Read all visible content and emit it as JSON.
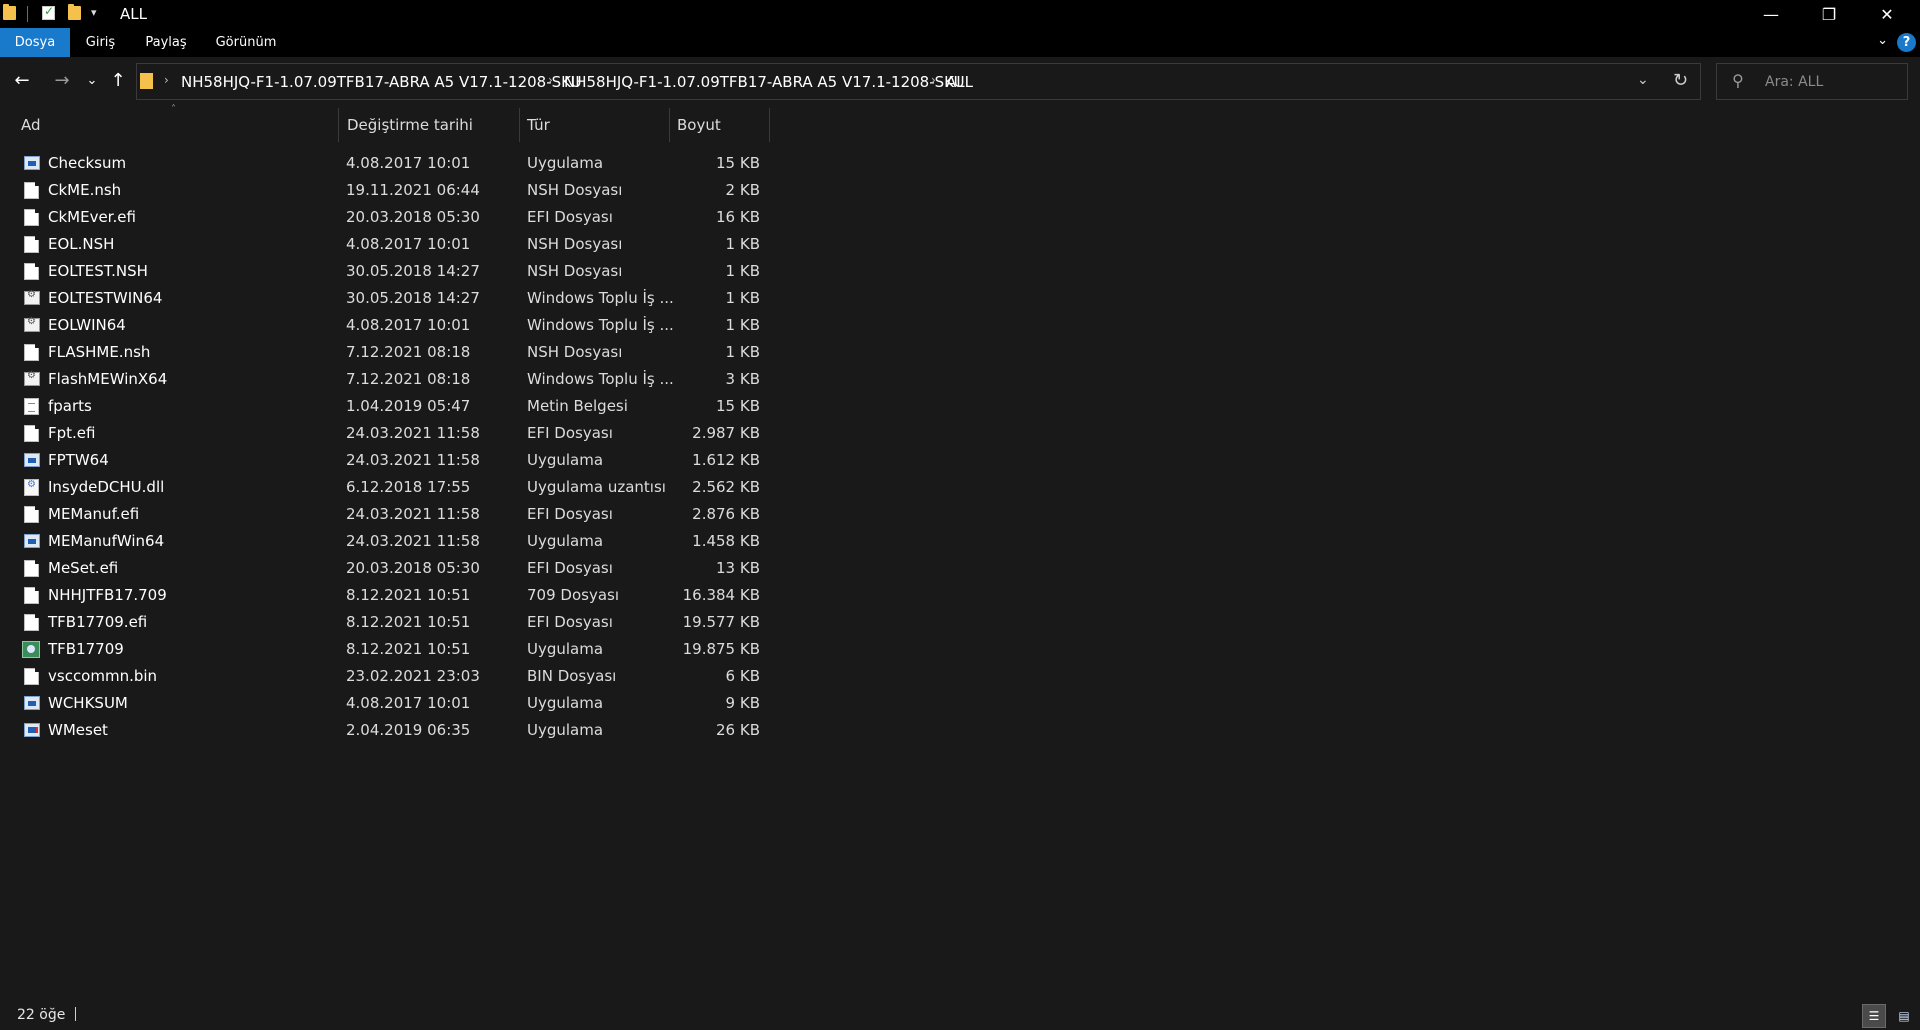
{
  "window": {
    "title": "ALL",
    "controls": {
      "minimize": "—",
      "restore": "❐",
      "close": "✕"
    }
  },
  "quick_access": {
    "dropdown_glyph": "▾"
  },
  "ribbon": {
    "tabs": [
      {
        "label": "Dosya",
        "active": true
      },
      {
        "label": "Giriş"
      },
      {
        "label": "Paylaş"
      },
      {
        "label": "Görünüm"
      }
    ],
    "collapse_glyph": "⌄",
    "help_glyph": "?"
  },
  "nav": {
    "back": "←",
    "forward": "→",
    "recent": "⌄",
    "up": "↑"
  },
  "address": {
    "crumbs": [
      "NH58HJQ-F1-1.07.09TFB17-ABRA A5 V17.1-1208-SKU",
      "NH58HJQ-F1-1.07.09TFB17-ABRA A5 V17.1-1208-SKU",
      "ALL"
    ],
    "separator": "›",
    "dropdown_glyph": "⌄",
    "refresh_glyph": "↻"
  },
  "search": {
    "placeholder": "Ara: ALL",
    "icon_glyph": "⚲"
  },
  "columns": {
    "name": "Ad",
    "date": "Değiştirme tarihi",
    "type": "Tür",
    "size": "Boyut",
    "sort_glyph": "˄"
  },
  "files": [
    {
      "name": "Checksum",
      "date": "4.08.2017 10:01",
      "type": "Uygulama",
      "size": "15 KB",
      "icon": "application-icon"
    },
    {
      "name": "CkME.nsh",
      "date": "19.11.2021 06:44",
      "type": "NSH Dosyası",
      "size": "2 KB",
      "icon": "file-icon"
    },
    {
      "name": "CkMEver.efi",
      "date": "20.03.2018 05:30",
      "type": "EFI Dosyası",
      "size": "16 KB",
      "icon": "file-icon"
    },
    {
      "name": "EOL.NSH",
      "date": "4.08.2017 10:01",
      "type": "NSH Dosyası",
      "size": "1 KB",
      "icon": "file-icon"
    },
    {
      "name": "EOLTEST.NSH",
      "date": "30.05.2018 14:27",
      "type": "NSH Dosyası",
      "size": "1 KB",
      "icon": "file-icon"
    },
    {
      "name": "EOLTESTWIN64",
      "date": "30.05.2018 14:27",
      "type": "Windows Toplu İş ...",
      "size": "1 KB",
      "icon": "batch-file-icon"
    },
    {
      "name": "EOLWIN64",
      "date": "4.08.2017 10:01",
      "type": "Windows Toplu İş ...",
      "size": "1 KB",
      "icon": "batch-file-icon"
    },
    {
      "name": "FLASHME.nsh",
      "date": "7.12.2021 08:18",
      "type": "NSH Dosyası",
      "size": "1 KB",
      "icon": "file-icon"
    },
    {
      "name": "FlashMEWinX64",
      "date": "7.12.2021 08:18",
      "type": "Windows Toplu İş ...",
      "size": "3 KB",
      "icon": "batch-file-icon"
    },
    {
      "name": "fparts",
      "date": "1.04.2019 05:47",
      "type": "Metin Belgesi",
      "size": "15 KB",
      "icon": "text-document-icon"
    },
    {
      "name": "Fpt.efi",
      "date": "24.03.2021 11:58",
      "type": "EFI Dosyası",
      "size": "2.987 KB",
      "icon": "file-icon"
    },
    {
      "name": "FPTW64",
      "date": "24.03.2021 11:58",
      "type": "Uygulama",
      "size": "1.612 KB",
      "icon": "application-icon"
    },
    {
      "name": "InsydeDCHU.dll",
      "date": "6.12.2018 17:55",
      "type": "Uygulama uzantısı",
      "size": "2.562 KB",
      "icon": "dll-icon"
    },
    {
      "name": "MEManuf.efi",
      "date": "24.03.2021 11:58",
      "type": "EFI Dosyası",
      "size": "2.876 KB",
      "icon": "file-icon"
    },
    {
      "name": "MEManufWin64",
      "date": "24.03.2021 11:58",
      "type": "Uygulama",
      "size": "1.458 KB",
      "icon": "application-icon"
    },
    {
      "name": "MeSet.efi",
      "date": "20.03.2018 05:30",
      "type": "EFI Dosyası",
      "size": "13 KB",
      "icon": "file-icon"
    },
    {
      "name": "NHHJTFB17.709",
      "date": "8.12.2021 10:51",
      "type": "709 Dosyası",
      "size": "16.384 KB",
      "icon": "file-icon"
    },
    {
      "name": "TFB17709.efi",
      "date": "8.12.2021 10:51",
      "type": "EFI Dosyası",
      "size": "19.577 KB",
      "icon": "file-icon"
    },
    {
      "name": "TFB17709",
      "date": "8.12.2021 10:51",
      "type": "Uygulama",
      "size": "19.875 KB",
      "icon": "setup-application-icon"
    },
    {
      "name": "vsccommn.bin",
      "date": "23.02.2021 23:03",
      "type": "BIN Dosyası",
      "size": "6 KB",
      "icon": "file-icon"
    },
    {
      "name": "WCHKSUM",
      "date": "4.08.2017 10:01",
      "type": "Uygulama",
      "size": "9 KB",
      "icon": "application-icon"
    },
    {
      "name": "WMeset",
      "date": "2.04.2019 06:35",
      "type": "Uygulama",
      "size": "26 KB",
      "icon": "windows-application-icon"
    }
  ],
  "status": {
    "item_count": "22 öğe"
  },
  "view_buttons": {
    "details_glyph": "☰",
    "tiles_glyph": "▤"
  },
  "colors": {
    "background": "#191919",
    "titlebar": "#000000",
    "accent": "#1979ca",
    "folder": "#f3c14c"
  }
}
